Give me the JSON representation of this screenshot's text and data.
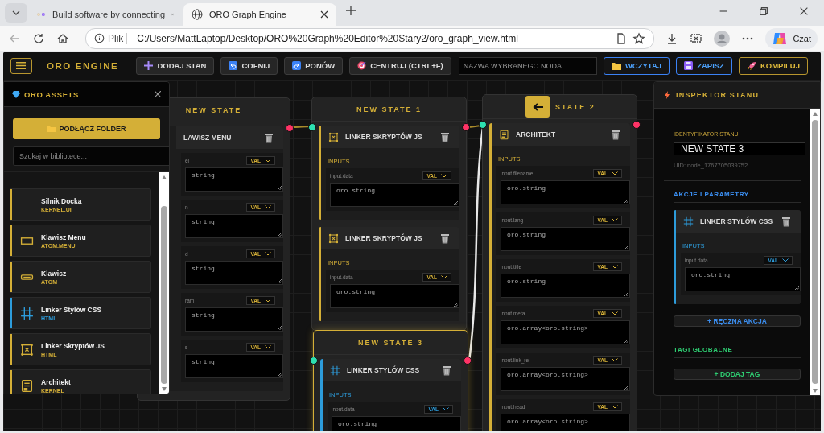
{
  "browser": {
    "tabs": [
      {
        "title": "Build software by connecting",
        "selected": false,
        "kind": "app"
      },
      {
        "title": "ORO Graph Engine",
        "selected": true,
        "kind": "web"
      }
    ],
    "address": {
      "scheme_label": "Plik",
      "url": "C:/Users/MattLaptop/Desktop/ORO%20Graph%20Editor%20Stary2/oro_graph_view.html"
    },
    "copilot_label": "Czat"
  },
  "toolbar": {
    "brand": "ORO ENGINE",
    "buttons": [
      {
        "label": "DODAJ STAN",
        "kind": "add"
      },
      {
        "label": "COFNIJ",
        "kind": "undo"
      },
      {
        "label": "PONÓW",
        "kind": "redo"
      },
      {
        "label": "CENTRUJ (CTRL+F)",
        "kind": "center"
      }
    ],
    "node_name": {
      "placeholder": "NAZWA WYBRANEGO NODA..."
    },
    "file_buttons": [
      {
        "label": "WCZYTAJ",
        "kind": "load"
      },
      {
        "label": "ZAPISZ",
        "kind": "save"
      },
      {
        "label": "KOMPILUJ",
        "kind": "compile"
      }
    ]
  },
  "graph": {
    "nodes": [
      {
        "title": "NEW STATE",
        "selected": false,
        "back_button": false,
        "actions": [
          {
            "title": "LAWISZ MENU",
            "inputs": [
              {
                "label": "el",
                "mode": "VAL",
                "value": "string"
              },
              {
                "label": "n",
                "mode": "VAL",
                "value": "string"
              },
              {
                "label": "d",
                "mode": "VAL",
                "value": "string"
              },
              {
                "label": "ram",
                "mode": "VAL",
                "value": "string"
              },
              {
                "label": "s",
                "mode": "VAL",
                "value": "string"
              }
            ]
          }
        ]
      },
      {
        "title": "NEW STATE 1",
        "selected": false,
        "back_button": false,
        "actions": [
          {
            "title": "LINKER SKRYPTÓW JS",
            "kind": "js",
            "color": "#d4af37",
            "inputs_label": "INPUTS",
            "inputs": [
              {
                "label": "input.data",
                "mode": "VAL",
                "value": "oro.string"
              }
            ]
          },
          {
            "title": "LINKER SKRYPTÓW JS",
            "kind": "js",
            "color": "#d4af37",
            "inputs_label": "INPUTS",
            "inputs": [
              {
                "label": "input.data",
                "mode": "VAL",
                "value": "oro.string"
              }
            ]
          }
        ]
      },
      {
        "title": "NEW STATE 3",
        "selected": true,
        "back_button": false,
        "actions": [
          {
            "title": "LINKER STYLÓW CSS",
            "kind": "css",
            "color": "#2d9cdb",
            "inputs_label": "INPUTS",
            "inputs": [
              {
                "label": "input.data",
                "mode": "VAL",
                "value": "oro.string"
              }
            ]
          }
        ]
      },
      {
        "title": "STATE 2",
        "selected": false,
        "back_button": true,
        "actions": [
          {
            "title": "ARCHITEKT",
            "kind": "kernel",
            "color": "#d4af37",
            "inputs_label": "INPUTS",
            "inputs": [
              {
                "label": "input.filename",
                "mode": "VAL",
                "value": "oro.string"
              },
              {
                "label": "input.lang",
                "mode": "VAL",
                "value": "oro.string"
              },
              {
                "label": "input.title",
                "mode": "VAL",
                "value": "oro.string"
              },
              {
                "label": "input.meta",
                "mode": "VAL",
                "value": "oro.array<oro.string>"
              },
              {
                "label": "input.link_rel",
                "mode": "VAL",
                "value": "oro.array<oro.string>"
              },
              {
                "label": "input.head",
                "mode": "VAL",
                "value": "oro.array<oro.string>"
              }
            ]
          }
        ]
      }
    ]
  },
  "assets": {
    "title": "ORO ASSETS",
    "connect_button": "PODŁĄCZ FOLDER",
    "search": {
      "placeholder": "Szukaj w bibliotece..."
    },
    "items": [
      {
        "name": "Silnik Docka",
        "category": "KERNEL.UI",
        "kind": "none",
        "color": "#d4af37"
      },
      {
        "name": "Klawisz Menu",
        "category": "ATOM.MENU",
        "kind": "menu",
        "color": "#d4af37"
      },
      {
        "name": "Klawisz",
        "category": "ATOM",
        "kind": "key",
        "color": "#d4af37"
      },
      {
        "name": "Linker Stylów CSS",
        "category": "HTML",
        "kind": "css",
        "color": "#2d9cdb"
      },
      {
        "name": "Linker Skryptów JS",
        "category": "HTML",
        "kind": "js",
        "color": "#d4af37"
      },
      {
        "name": "Architekt",
        "category": "KERNEL",
        "kind": "kernel",
        "color": "#d4af37"
      }
    ]
  },
  "inspector": {
    "title": "INSPEKTOR STANU",
    "id_label": "IDENTYFIKATOR STANU",
    "id_value": "NEW STATE 3",
    "uid": "UID: node_1767705039752",
    "actions_heading": "AKCJE I PARAMETRY",
    "actions": [
      {
        "title": "LINKER STYLÓW CSS",
        "kind": "css",
        "color": "#2d9cdb",
        "inputs_label": "INPUTS",
        "inputs": [
          {
            "label": "input.data",
            "mode": "VAL",
            "value": "oro.string"
          }
        ]
      }
    ],
    "add_action_button": "+ RĘCZNA AKCJA",
    "tags_heading": "TAGI GLOBALNE",
    "add_tag_button": "+ DODAJ TAG"
  }
}
